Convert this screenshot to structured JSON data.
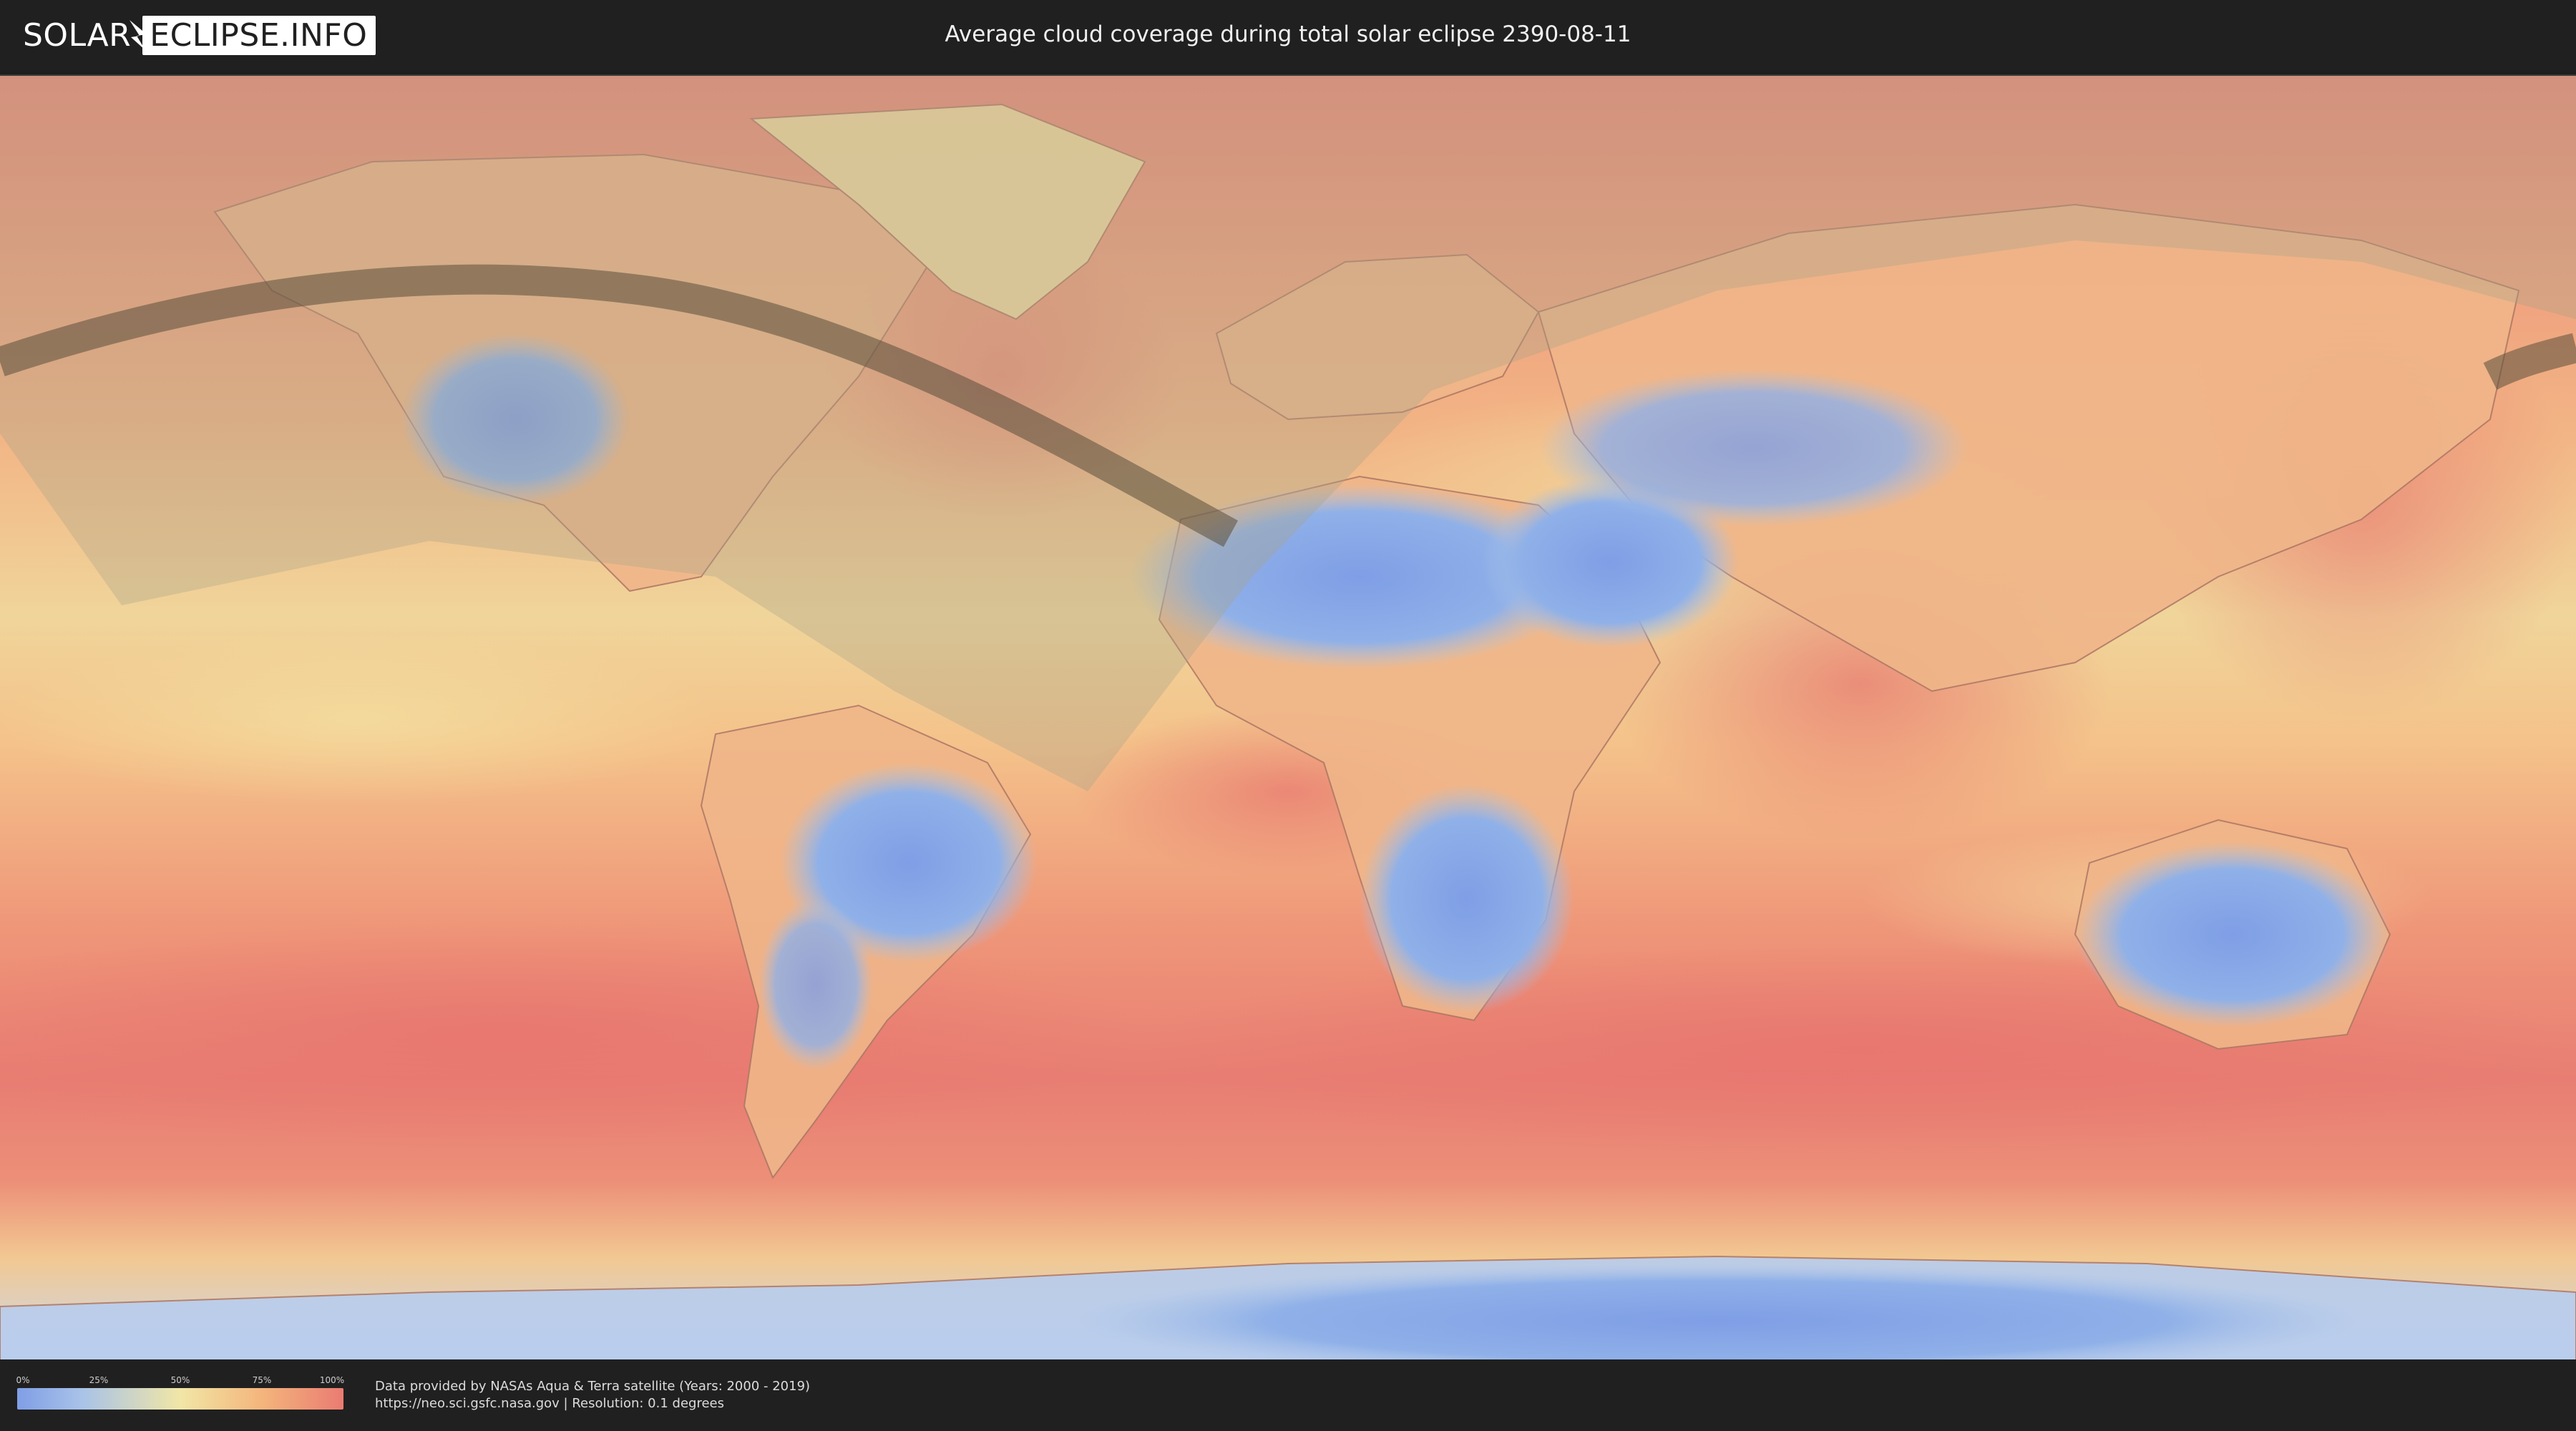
{
  "header": {
    "logo_part1": "SOLAR",
    "logo_part2": "ECLIPSE.INFO",
    "title": "Average cloud coverage during total solar eclipse 2390-08-11"
  },
  "map": {
    "icon": "world-map-icon",
    "colors": {
      "clear": "#7f9ee6",
      "low": "#a9c3e8",
      "mid": "#f1e6a6",
      "high": "#f4b57c",
      "overcast": "#ea7b72",
      "eclipse_path": "#5a4e3c",
      "visibility_shade": "#c9b98a"
    }
  },
  "legend": {
    "ticks": [
      "0%",
      "25%",
      "50%",
      "75%",
      "100%"
    ]
  },
  "footer": {
    "credit_line1": "Data provided by NASAs Aqua & Terra satellite (Years: 2000 - 2019)",
    "credit_line2": "https://neo.sci.gsfc.nasa.gov | Resolution: 0.1 degrees"
  }
}
